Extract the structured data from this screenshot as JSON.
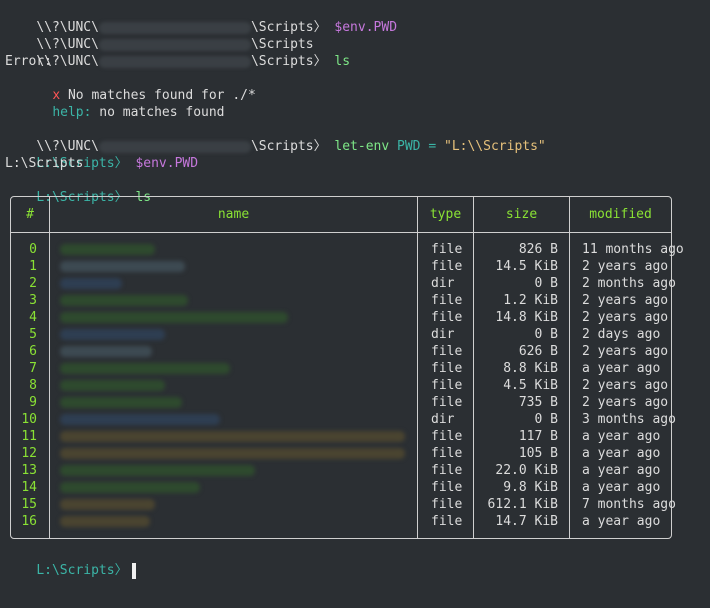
{
  "lines": {
    "l1_prefix": "\\\\?\\UNC\\",
    "l1_suffix": "\\Scripts",
    "l1_cmd": "$env.PWD",
    "l2_prefix": "\\\\?\\UNC\\",
    "l2_suffix": "\\Scripts",
    "l3_prefix": "\\\\?\\UNC\\",
    "l3_suffix": "\\Scripts",
    "l3_cmd": "ls",
    "error_label": "Error:",
    "error_x": "x",
    "error_msg": " No matches found for ./*",
    "help_label": "help:",
    "help_msg": " no matches found",
    "l5_prefix": "\\\\?\\UNC\\",
    "l5_suffix": "\\Scripts",
    "l5_cmd_a": "let-env",
    "l5_cmd_b": " PWD = ",
    "l5_cmd_c": "\"L:\\\\Scripts\"",
    "l6_path": "L:\\Scripts",
    "l6_cmd": "$env.PWD",
    "l7_out": "L:\\Scripts",
    "l8_path": "L:\\Scripts",
    "l8_cmd": "ls",
    "final_path": "L:\\Scripts"
  },
  "prompt_arrow": "〉",
  "table": {
    "headers": {
      "idx": "#",
      "name": "name",
      "type": "type",
      "size": "size",
      "modified": "modified"
    },
    "rows": [
      {
        "idx": "0",
        "type": "file",
        "size": "826 B",
        "modified": "11 months ago"
      },
      {
        "idx": "1",
        "type": "file",
        "size": "14.5 KiB",
        "modified": "2 years ago"
      },
      {
        "idx": "2",
        "type": "dir",
        "size": "0 B",
        "modified": "2 months ago"
      },
      {
        "idx": "3",
        "type": "file",
        "size": "1.2 KiB",
        "modified": "2 years ago"
      },
      {
        "idx": "4",
        "type": "file",
        "size": "14.8 KiB",
        "modified": "2 years ago"
      },
      {
        "idx": "5",
        "type": "dir",
        "size": "0 B",
        "modified": "2 days ago"
      },
      {
        "idx": "6",
        "type": "file",
        "size": "626 B",
        "modified": "2 years ago"
      },
      {
        "idx": "7",
        "type": "file",
        "size": "8.8 KiB",
        "modified": "a year ago"
      },
      {
        "idx": "8",
        "type": "file",
        "size": "4.5 KiB",
        "modified": "2 years ago"
      },
      {
        "idx": "9",
        "type": "file",
        "size": "735 B",
        "modified": "2 years ago"
      },
      {
        "idx": "10",
        "type": "dir",
        "size": "0 B",
        "modified": "3 months ago"
      },
      {
        "idx": "11",
        "type": "file",
        "size": "117 B",
        "modified": "a year ago"
      },
      {
        "idx": "12",
        "type": "file",
        "size": "105 B",
        "modified": "a year ago"
      },
      {
        "idx": "13",
        "type": "file",
        "size": "22.0 KiB",
        "modified": "a year ago"
      },
      {
        "idx": "14",
        "type": "file",
        "size": "9.8 KiB",
        "modified": "a year ago"
      },
      {
        "idx": "15",
        "type": "file",
        "size": "612.1 KiB",
        "modified": "7 months ago"
      },
      {
        "idx": "16",
        "type": "file",
        "size": "14.7 KiB",
        "modified": "a year ago"
      }
    ]
  },
  "colors": {
    "background": "#2b2f33",
    "green": "#8ae234",
    "teal": "#3bb5a7",
    "purple": "#c678dd",
    "red": "#ff5555",
    "yellow": "#e5c07b"
  }
}
